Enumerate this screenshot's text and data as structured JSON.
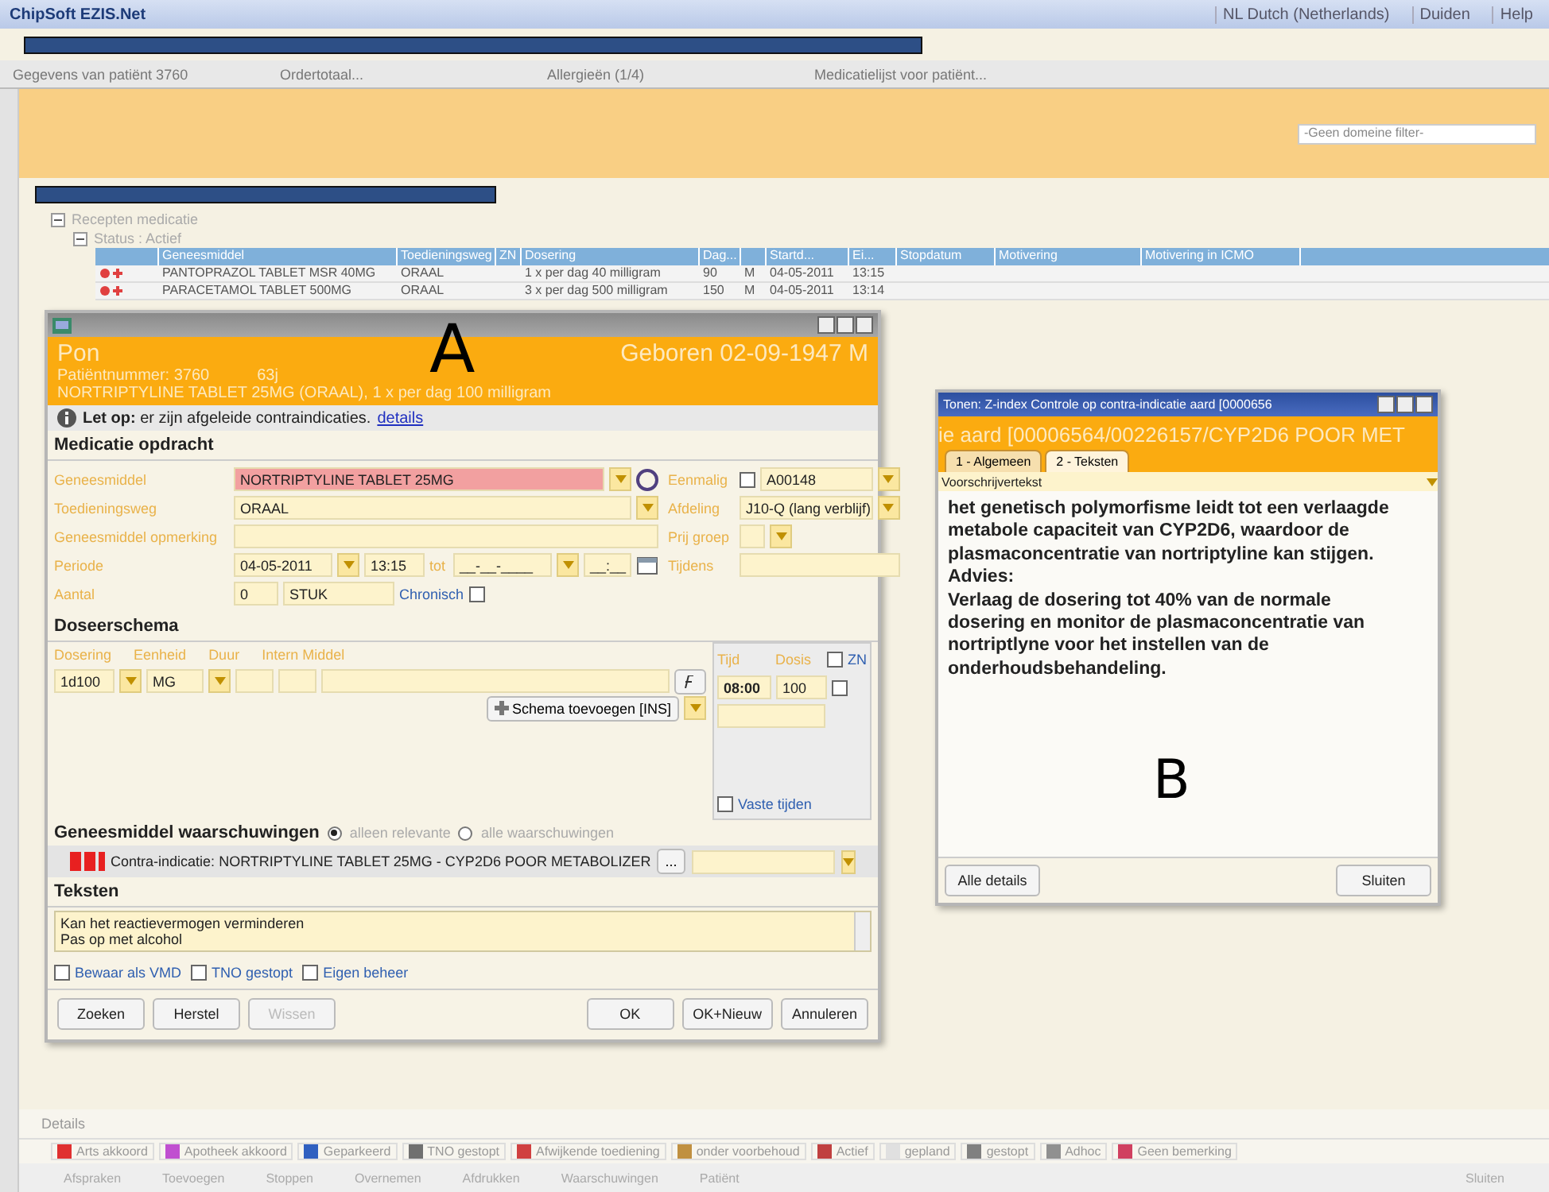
{
  "app_title": "ChipSoft EZIS.Net",
  "title_bar_items": [
    "NL Dutch (Netherlands)",
    "Duiden",
    "Help"
  ],
  "doc_tabs": [
    "Gegevens van patiënt 3760",
    "Ordertotaal...",
    "Allergieën (1/4)",
    "Medicatielijst voor patiënt..."
  ],
  "filter": {
    "value": "-Geen domeine filter-"
  },
  "tree": [
    {
      "label": "Recepten medicatie",
      "expanded": true,
      "children": [
        {
          "label": "Status : Actief",
          "expanded": true
        }
      ]
    }
  ],
  "table": {
    "columns": [
      {
        "label": "Geneesmiddel"
      },
      {
        "label": "Toedieningsweg"
      },
      {
        "label": "ZN"
      },
      {
        "label": "Dosering"
      },
      {
        "label": "Dag..."
      },
      {},
      {
        "label": "Startd..."
      },
      {
        "label": "Ei..."
      },
      {
        "label": "Stopdatum"
      },
      {
        "label": "Motivering"
      },
      {
        "label": "Motivering in ICMO"
      }
    ],
    "rows": [
      {
        "cells": [
          "PANTOPRAZOL TABLET MSR 40MG",
          "ORAAL",
          "",
          "1 x per dag 40 milligram",
          "90",
          "M",
          "04-05-2011",
          "13:15",
          "",
          "",
          ""
        ]
      },
      {
        "cells": [
          "PARACETAMOL TABLET 500MG",
          "ORAAL",
          "",
          "3 x per dag 500 milligram",
          "150",
          "M",
          "04-05-2011",
          "13:14",
          "",
          "",
          ""
        ]
      }
    ]
  },
  "dialog_a": {
    "annotation": "A",
    "header": {
      "name": "Pon",
      "born": "Geboren 02-09-1947 M",
      "patient_number": "Patiëntnummer: 3760",
      "age": "63j",
      "order": "NORTRIPTYLINE TABLET 25MG  (ORAAL), 1 x per dag 100 milligram"
    },
    "notice": "**Let op:** er zijn afgeleide contraindicaties.",
    "notice_link": "details",
    "section_order": "Medicatie opdracht",
    "fields": [
      {
        "label": "Geneesmiddel",
        "value": "NORTRIPTYLINE TABLET 25MG",
        "kind": "drug",
        "alert": true
      },
      {
        "label": "Toedieningsweg",
        "value": "ORAAL",
        "kind": "select",
        "alert": false
      },
      {
        "label": "Geneesmiddel opmerking",
        "kind": "text",
        "alert": false
      }
    ],
    "period": {
      "label": "Periode",
      "start_date": "04-05-2011",
      "start_time": "13:15",
      "until": "tot",
      "end_date": "__-__-____",
      "end_time": "__:__"
    },
    "amount": {
      "label": "Aantal",
      "value": "0",
      "unit": "STUK",
      "chronic_label": "Chronisch",
      "chronic": false
    },
    "right_fields": [
      {
        "label": "Eenmalig",
        "value": "A00148",
        "kind": "check",
        "checked": false
      },
      {
        "label": "Afdeling",
        "value": "J10-Q (lang verblijf)",
        "kind": "select"
      },
      {
        "label": "Prij groep",
        "kind": "small"
      },
      {
        "label": "Tijdens",
        "kind": "text"
      }
    ],
    "section_schema": "Doseerschema",
    "schema_columns": [
      "Dosering",
      "Eenheid",
      "Duur",
      "Intern Middel"
    ],
    "schema_row": {
      "dosering": "1d100",
      "eenheid": "MG"
    },
    "time_columns": [
      "Tijd",
      "Dosis"
    ],
    "zn_label": "ZN",
    "zn": false,
    "time_row": {
      "time": "08:00",
      "dose": "100",
      "checked": false
    },
    "add_schema": "Schema toevoegen [INS]",
    "fixed_times": {
      "label": "Vaste tijden",
      "checked": false
    },
    "warnings": {
      "title": "Geneesmiddel waarschuwingen",
      "options": [
        {
          "label": "alleen relevante",
          "selected": true
        },
        {
          "label": "alle waarschuwingen",
          "selected": false
        }
      ],
      "item": "Contra-indicatie: NORTRIPTYLINE TABLET 25MG - CYP2D6 POOR METABOLIZER",
      "more": "..."
    },
    "section_texts": "Teksten",
    "texts": [
      "Kan het reactievermogen verminderen",
      "Pas op met alcohol"
    ],
    "checks": [
      {
        "label": "Bewaar als VMD",
        "checked": false
      },
      {
        "label": "TNO gestopt",
        "checked": false
      },
      {
        "label": "Eigen beheer",
        "checked": false
      }
    ],
    "buttons_left": [
      {
        "label": "Zoeken",
        "disabled": false
      },
      {
        "label": "Herstel",
        "disabled": false
      },
      {
        "label": "Wissen",
        "disabled": true
      }
    ],
    "buttons_right": [
      {
        "label": "OK",
        "disabled": false
      },
      {
        "label": "OK+Nieuw",
        "disabled": false
      },
      {
        "label": "Annuleren",
        "disabled": false
      }
    ]
  },
  "dialog_b": {
    "annotation": "B",
    "title": "Tonen: Z-index Controle op contra-indicatie aard [0000656",
    "header": "ie aard [00006564/00226157/CYP2D6 POOR MET",
    "tabs": [
      {
        "label": "1 - Algemeen",
        "selected": false
      },
      {
        "label": "2 - Teksten",
        "selected": true
      }
    ],
    "select": "Voorschrijvertekst",
    "paragraphs": [
      "het genetisch polymorfisme leidt tot een verlaagde metabole capaciteit van CYP2D6, waardoor de plasmaconcentratie van nortriptyline kan stijgen.",
      "Advies:",
      "Verlaag de dosering tot 40% van de normale dosering en monitor de plasmaconcentratie van nortriptlyne voor het instellen van de onderhoudsbehandeling."
    ],
    "buttons": [
      "Alle details",
      "Sluiten"
    ]
  },
  "details": {
    "title": "Details",
    "legend": [
      {
        "label": "Arts akkoord",
        "color": "#e03030"
      },
      {
        "label": "Apotheek akkoord",
        "color": "#c050d0"
      },
      {
        "label": "Geparkeerd",
        "color": "#3060c0"
      },
      {
        "label": "TNO gestopt",
        "color": "#707070"
      },
      {
        "label": "Afwijkende toediening",
        "color": "#d04040"
      },
      {
        "label": "onder voorbehoud",
        "color": "#c09040"
      },
      {
        "label": "Actief",
        "color": "#c04040"
      },
      {
        "label": "gepland",
        "color": "#e0e0e0"
      },
      {
        "label": "gestopt",
        "color": "#808080"
      },
      {
        "label": "Adhoc",
        "color": "#909090"
      },
      {
        "label": "Geen bemerking",
        "color": "#d04060"
      }
    ],
    "toolbar": [
      "Afspraken",
      "Toevoegen",
      "Stoppen",
      "Overnemen",
      "Afdrukken",
      "Waarschuwingen",
      "Patiënt"
    ],
    "close": "Sluiten"
  }
}
